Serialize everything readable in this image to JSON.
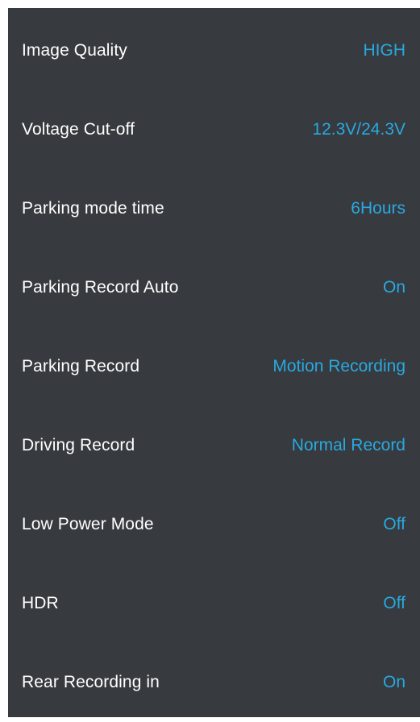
{
  "colors": {
    "background": "#373a3f",
    "label": "#ffffff",
    "value": "#29a9e0"
  },
  "settings": [
    {
      "label": "Image Quality",
      "value": "HIGH"
    },
    {
      "label": "Voltage Cut-off",
      "value": "12.3V/24.3V"
    },
    {
      "label": "Parking mode time",
      "value": "6Hours"
    },
    {
      "label": "Parking Record Auto",
      "value": "On"
    },
    {
      "label": "Parking Record",
      "value": "Motion Recording"
    },
    {
      "label": "Driving Record",
      "value": "Normal Record"
    },
    {
      "label": "Low Power Mode",
      "value": "Off"
    },
    {
      "label": "HDR",
      "value": "Off"
    },
    {
      "label": "Rear Recording in",
      "value": "On"
    }
  ]
}
